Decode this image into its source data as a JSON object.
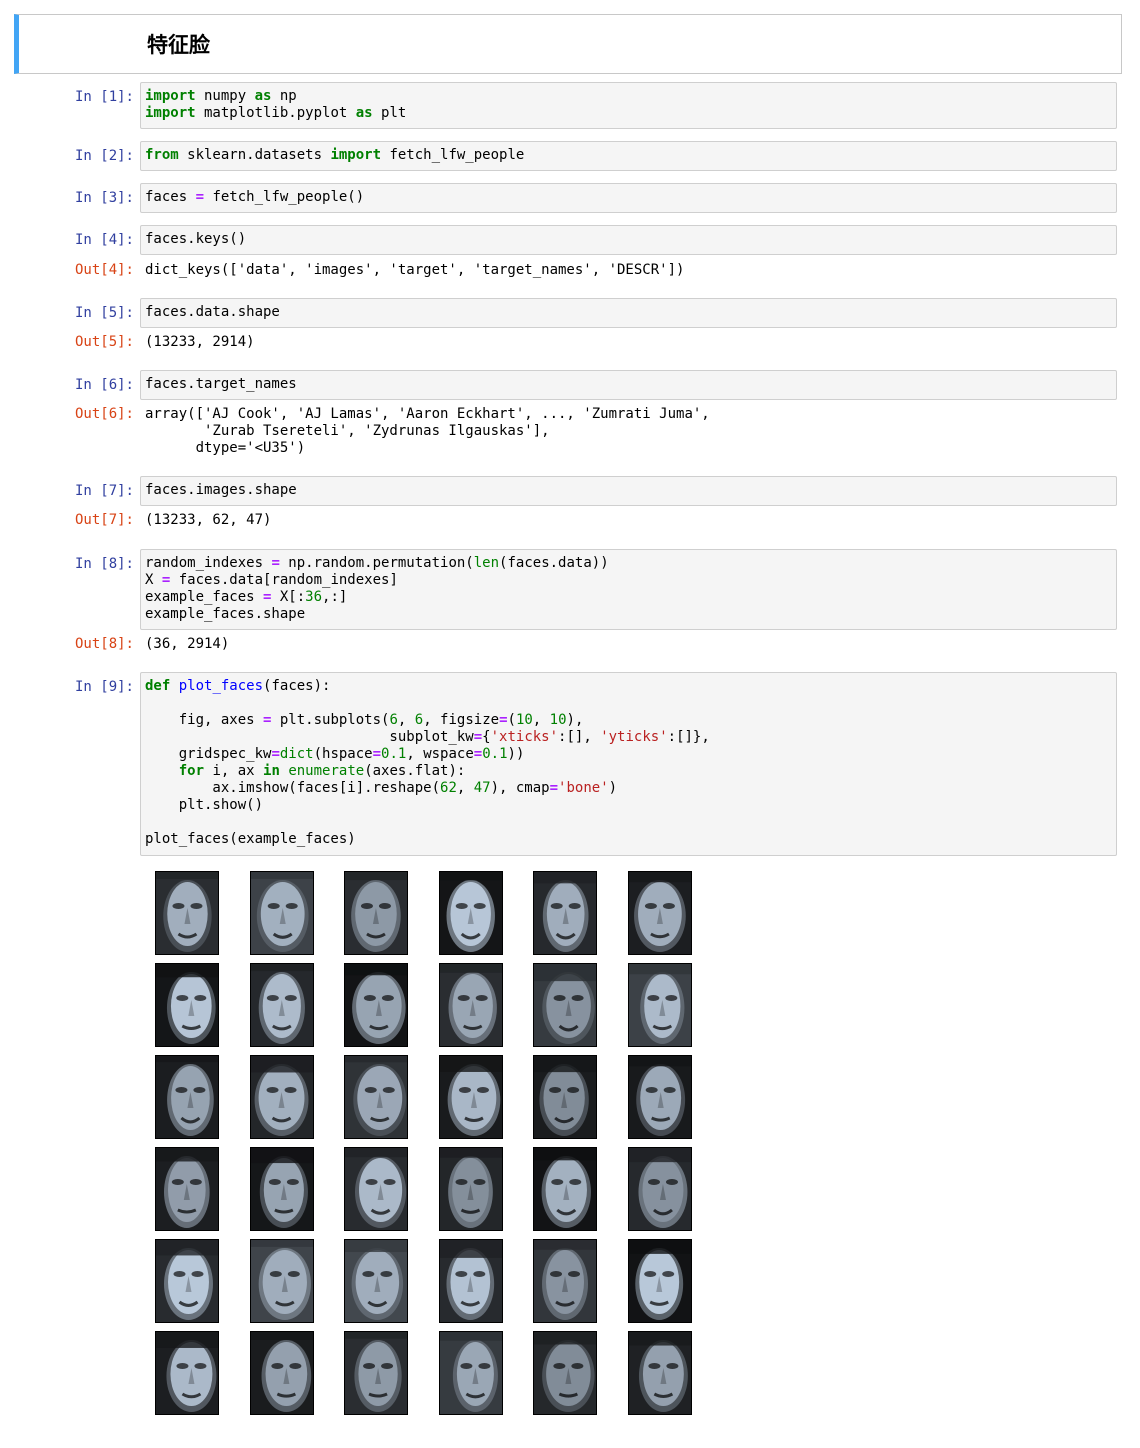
{
  "title": "特征脸",
  "cells": [
    {
      "in_prompt": "In [1]:",
      "code": [
        [
          [
            "kw",
            "import"
          ],
          [
            "t",
            " numpy "
          ],
          [
            "kw",
            "as"
          ],
          [
            "t",
            " np"
          ]
        ],
        [
          [
            "kw",
            "import"
          ],
          [
            "t",
            " matplotlib.pyplot "
          ],
          [
            "kw",
            "as"
          ],
          [
            "t",
            " plt"
          ]
        ]
      ]
    },
    {
      "in_prompt": "In [2]:",
      "code": [
        [
          [
            "kw",
            "from"
          ],
          [
            "t",
            " sklearn.datasets "
          ],
          [
            "kw",
            "import"
          ],
          [
            "t",
            " fetch_lfw_people"
          ]
        ]
      ]
    },
    {
      "in_prompt": "In [3]:",
      "code": [
        [
          [
            "t",
            "faces "
          ],
          [
            "op",
            "="
          ],
          [
            "t",
            " fetch_lfw_people()"
          ]
        ]
      ]
    },
    {
      "in_prompt": "In [4]:",
      "code": [
        [
          [
            "t",
            "faces.keys()"
          ]
        ]
      ],
      "out_prompt": "Out[4]:",
      "output": [
        "dict_keys(['data', 'images', 'target', 'target_names', 'DESCR'])"
      ]
    },
    {
      "in_prompt": "In [5]:",
      "code": [
        [
          [
            "t",
            "faces.data.shape"
          ]
        ]
      ],
      "out_prompt": "Out[5]:",
      "output": [
        "(13233, 2914)"
      ]
    },
    {
      "in_prompt": "In [6]:",
      "code": [
        [
          [
            "t",
            "faces.target_names"
          ]
        ]
      ],
      "out_prompt": "Out[6]:",
      "output": [
        "array(['AJ Cook', 'AJ Lamas', 'Aaron Eckhart', ..., 'Zumrati Juma',",
        "       'Zurab Tsereteli', 'Zydrunas Ilgauskas'],",
        "      dtype='<U35')"
      ]
    },
    {
      "in_prompt": "In [7]:",
      "code": [
        [
          [
            "t",
            "faces.images.shape"
          ]
        ]
      ],
      "out_prompt": "Out[7]:",
      "output": [
        "(13233, 62, 47)"
      ]
    },
    {
      "in_prompt": "In [8]:",
      "code": [
        [
          [
            "t",
            "random_indexes "
          ],
          [
            "op",
            "="
          ],
          [
            "t",
            " np.random.permutation("
          ],
          [
            "bi",
            "len"
          ],
          [
            "t",
            "(faces.data))"
          ]
        ],
        [
          [
            "t",
            "X "
          ],
          [
            "op",
            "="
          ],
          [
            "t",
            " faces.data[random_indexes]"
          ]
        ],
        [
          [
            "t",
            "example_faces "
          ],
          [
            "op",
            "="
          ],
          [
            "t",
            " X[:"
          ],
          [
            "num",
            "36"
          ],
          [
            "t",
            ",:]"
          ]
        ],
        [
          [
            "t",
            "example_faces.shape"
          ]
        ]
      ],
      "out_prompt": "Out[8]:",
      "output": [
        "(36, 2914)"
      ]
    },
    {
      "in_prompt": "In [9]:",
      "code": [
        [
          [
            "kw",
            "def"
          ],
          [
            "t",
            " "
          ],
          [
            "fn",
            "plot_faces"
          ],
          [
            "t",
            "(faces):"
          ]
        ],
        [],
        [
          [
            "t",
            "    fig, axes "
          ],
          [
            "op",
            "="
          ],
          [
            "t",
            " plt.subplots("
          ],
          [
            "num",
            "6"
          ],
          [
            "t",
            ", "
          ],
          [
            "num",
            "6"
          ],
          [
            "t",
            ", figsize"
          ],
          [
            "op",
            "="
          ],
          [
            "t",
            "("
          ],
          [
            "num",
            "10"
          ],
          [
            "t",
            ", "
          ],
          [
            "num",
            "10"
          ],
          [
            "t",
            "),"
          ]
        ],
        [
          [
            "t",
            "                             subplot_kw"
          ],
          [
            "op",
            "="
          ],
          [
            "t",
            "{"
          ],
          [
            "str",
            "'xticks'"
          ],
          [
            "t",
            ":[], "
          ],
          [
            "str",
            "'yticks'"
          ],
          [
            "t",
            ":[]},"
          ]
        ],
        [
          [
            "t",
            "    gridspec_kw"
          ],
          [
            "op",
            "="
          ],
          [
            "bi",
            "dict"
          ],
          [
            "t",
            "(hspace"
          ],
          [
            "op",
            "="
          ],
          [
            "num",
            "0.1"
          ],
          [
            "t",
            ", wspace"
          ],
          [
            "op",
            "="
          ],
          [
            "num",
            "0.1"
          ],
          [
            "t",
            "))"
          ]
        ],
        [
          [
            "t",
            "    "
          ],
          [
            "kw",
            "for"
          ],
          [
            "t",
            " i, ax "
          ],
          [
            "kw",
            "in"
          ],
          [
            "t",
            " "
          ],
          [
            "bi",
            "enumerate"
          ],
          [
            "t",
            "(axes.flat):"
          ]
        ],
        [
          [
            "t",
            "        ax.imshow(faces[i].reshape("
          ],
          [
            "num",
            "62"
          ],
          [
            "t",
            ", "
          ],
          [
            "num",
            "47"
          ],
          [
            "t",
            "), cmap"
          ],
          [
            "op",
            "="
          ],
          [
            "str",
            "'bone'"
          ],
          [
            "t",
            ")"
          ]
        ],
        [
          [
            "t",
            "    plt.show()"
          ]
        ],
        [],
        [
          [
            "t",
            "plot_faces(example_faces)"
          ]
        ]
      ]
    }
  ],
  "figure": {
    "rows": 6,
    "cols": 6,
    "cmap": "bone"
  }
}
